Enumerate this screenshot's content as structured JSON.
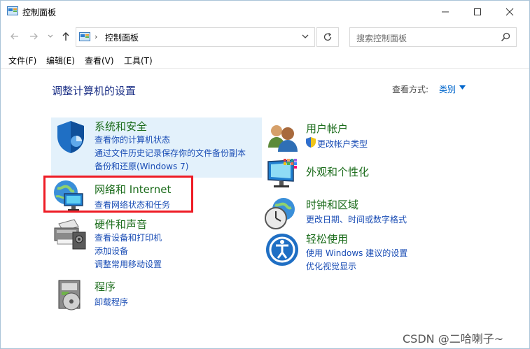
{
  "window": {
    "title": "控制面板"
  },
  "address": {
    "path": "控制面板",
    "separator": "›",
    "search_placeholder": "搜索控制面板"
  },
  "menu": {
    "items": [
      "文件(F)",
      "编辑(E)",
      "查看(V)",
      "工具(T)"
    ]
  },
  "header": {
    "title": "调整计算机的设置",
    "view_label": "查看方式:",
    "view_value": "类别"
  },
  "categories": {
    "system": {
      "title": "系统和安全",
      "links": [
        "查看你的计算机状态",
        "通过文件历史记录保存你的文件备份副本",
        "备份和还原(Windows 7)"
      ]
    },
    "network": {
      "title": "网络和 Internet",
      "links": [
        "查看网络状态和任务"
      ]
    },
    "hardware": {
      "title": "硬件和声音",
      "links": [
        "查看设备和打印机",
        "添加设备",
        "调整常用移动设置"
      ]
    },
    "programs": {
      "title": "程序",
      "links": [
        "卸载程序"
      ]
    },
    "users": {
      "title": "用户帐户",
      "links": [
        "更改帐户类型"
      ]
    },
    "appearance": {
      "title": "外观和个性化",
      "links": []
    },
    "clock": {
      "title": "时钟和区域",
      "links": [
        "更改日期、时间或数字格式"
      ]
    },
    "ease": {
      "title": "轻松使用",
      "links": [
        "使用 Windows 建议的设置",
        "优化视觉显示"
      ]
    }
  },
  "watermark": "CSDN @二哈喇子~",
  "colors": {
    "category_title": "#1b6c1b",
    "link": "#1a4db5",
    "heading": "#1e3287",
    "highlight_bg": "#e3f1fb",
    "annotation_red": "#ee1c25"
  }
}
